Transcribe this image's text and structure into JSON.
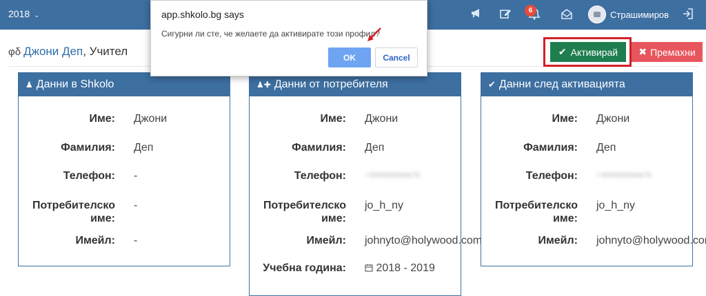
{
  "topbar": {
    "year": "2018",
    "badge_count": "6",
    "username": "Страшимиров"
  },
  "heading": {
    "name": "Джони Деп",
    "suffix": ", Учител"
  },
  "actions": {
    "activate": "Активирай",
    "remove": "Премахни"
  },
  "dialog": {
    "title": "app.shkolo.bg says",
    "message": "Сигурни ли сте, че желаете да активирате този профил?",
    "ok": "OK",
    "cancel": "Cancel"
  },
  "cards": [
    {
      "title": "Данни в Shkolo",
      "rows": [
        {
          "label": "Име:",
          "value": "Джони"
        },
        {
          "label": "Фамилия:",
          "value": "Деп"
        },
        {
          "label": "Телефон:",
          "value": "-"
        },
        {
          "label": "Потребителско име:",
          "value": "-"
        },
        {
          "label": "Имейл:",
          "value": "-"
        }
      ]
    },
    {
      "title": "Данни от потребителя",
      "rows": [
        {
          "label": "Име:",
          "value": "Джони"
        },
        {
          "label": "Фамилия:",
          "value": "Деп"
        },
        {
          "label": "Телефон:",
          "value": "+359999999678"
        },
        {
          "label": "Потребителско име:",
          "value": "jo_h_ny"
        },
        {
          "label": "Имейл:",
          "value": "johnyto@holywood.com"
        },
        {
          "label": "Учебна година:",
          "value": "2018 - 2019"
        }
      ]
    },
    {
      "title": "Данни след активацията",
      "rows": [
        {
          "label": "Име:",
          "value": "Джони"
        },
        {
          "label": "Фамилия:",
          "value": "Деп"
        },
        {
          "label": "Телефон:",
          "value": "+359999999678"
        },
        {
          "label": "Потребителско име:",
          "value": "jo_h_ny"
        },
        {
          "label": "Имейл:",
          "value": "johnyto@holywood.com"
        }
      ]
    }
  ],
  "icons": {
    "megaphone": "megaphone-icon",
    "edit": "edit-icon",
    "bell": "bell-icon",
    "mail": "mail-icon",
    "logout": "logout-icon"
  },
  "colors": {
    "header": "#3d6fa1",
    "activate": "#1e7e4f",
    "remove": "#e8565d",
    "highlight": "#d21f26",
    "ok": "#6fa4f2"
  }
}
